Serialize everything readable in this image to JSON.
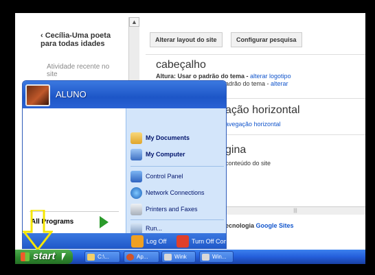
{
  "site": {
    "back_link": "‹ Cecília-Uma poeta para todas idades",
    "recent": "Atividade recente no site",
    "buttons": {
      "layout": "Alterar layout do site",
      "search": "Configurar pesquisa"
    },
    "header": {
      "title": "cabeçalho",
      "line1_prefix": "Altura: Usar o padrão do tema - ",
      "line1_link": "alterar logotipo",
      "line2_prefix": "Padrão do tema - ",
      "line2_link": "alterar"
    },
    "nav": {
      "title": "ação horizontal",
      "link": "avegação horizontal"
    },
    "page": {
      "title": "gina",
      "subtitle": "conteúdo do site"
    },
    "footer": {
      "prefix": "ecnologia ",
      "link": "Google Sites"
    }
  },
  "start_menu": {
    "user": "ALUNO",
    "all_programs": "All Programs",
    "right_items": [
      {
        "label": "My Documents",
        "icon": "folder-docs-icon"
      },
      {
        "label": "My Computer",
        "icon": "computer-icon"
      },
      {
        "label": "Control Panel",
        "icon": "control-panel-icon"
      },
      {
        "label": "Network Connections",
        "icon": "network-icon"
      },
      {
        "label": "Printers and Faxes",
        "icon": "printer-icon"
      },
      {
        "label": "Run...",
        "icon": "run-icon"
      }
    ],
    "log_off": "Log Off",
    "turn_off": "Turn Off Computer"
  },
  "taskbar": {
    "start": "start",
    "items": [
      "C:\\...",
      "Ap...",
      "Wink",
      "Win..."
    ]
  },
  "colors": {
    "xp_blue": "#245edb",
    "start_green": "#2f8a2f",
    "annotation_yellow": "#f5e600"
  }
}
